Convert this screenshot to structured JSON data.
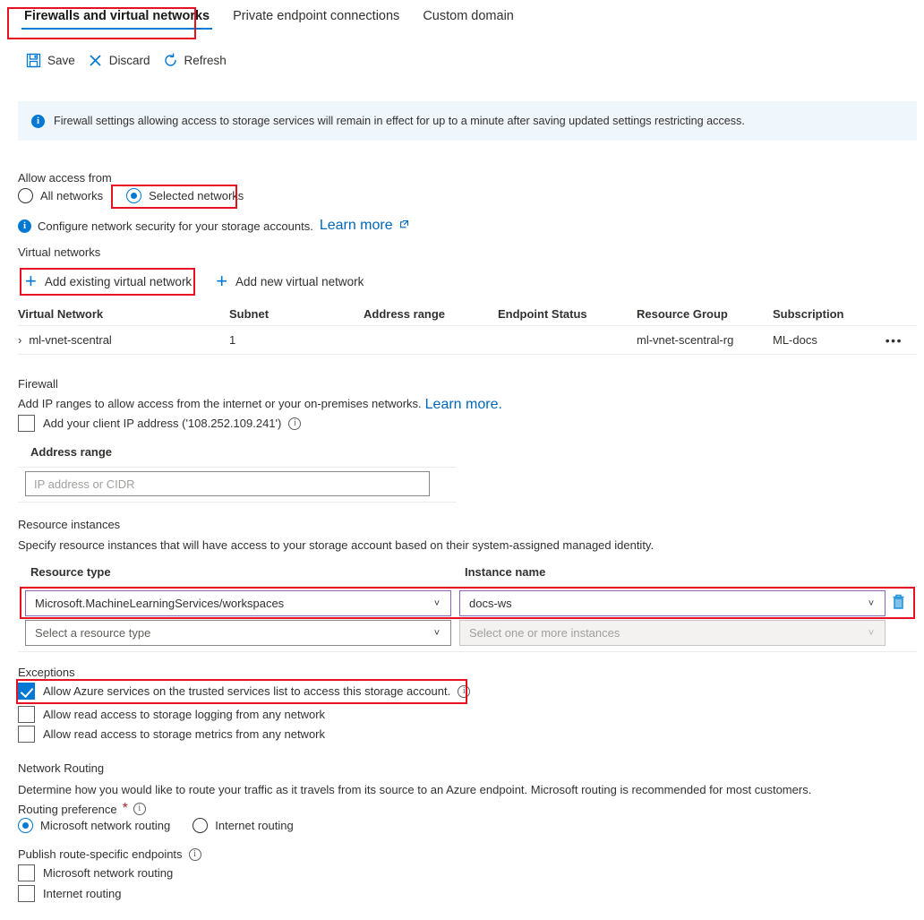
{
  "tabs": [
    {
      "label": "Firewalls and virtual networks",
      "active": true
    },
    {
      "label": "Private endpoint connections",
      "active": false
    },
    {
      "label": "Custom domain",
      "active": false
    }
  ],
  "toolbar": {
    "save_label": "Save",
    "discard_label": "Discard",
    "refresh_label": "Refresh"
  },
  "banner": {
    "text": "Firewall settings allowing access to storage services will remain in effect for up to a minute after saving updated settings restricting access."
  },
  "allow_access": {
    "heading": "Allow access from",
    "option_all": "All networks",
    "option_selected": "Selected networks",
    "selected_value": "Selected networks",
    "note": "Configure network security for your storage accounts.",
    "note_link": "Learn more"
  },
  "virtual_networks": {
    "heading": "Virtual networks",
    "add_existing": "Add existing virtual network",
    "add_new": "Add new virtual network",
    "columns": [
      "Virtual Network",
      "Subnet",
      "Address range",
      "Endpoint Status",
      "Resource Group",
      "Subscription"
    ],
    "rows": [
      {
        "virtual_network": "ml-vnet-scentral",
        "subnet": "1",
        "address_range": "",
        "endpoint_status": "",
        "resource_group": "ml-vnet-scentral-rg",
        "subscription": "ML-docs",
        "menu": "•••"
      }
    ]
  },
  "firewall": {
    "heading": "Firewall",
    "description": "Add IP ranges to allow access from the internet or your on-premises networks.",
    "description_link": "Learn more.",
    "client_ip_checkbox": "Add your client IP address ('108.252.109.241')",
    "client_ip_checked": false,
    "address_range_label": "Address range",
    "address_range_value": "",
    "address_range_placeholder": "IP address or CIDR"
  },
  "resource_instances": {
    "heading": "Resource instances",
    "description": "Specify resource instances that will have access to your storage account based on their system-assigned managed identity.",
    "col_resource_type": "Resource type",
    "col_instance_name": "Instance name",
    "rows": [
      {
        "resource_type": "Microsoft.MachineLearningServices/workspaces",
        "instance_name": "docs-ws",
        "has_delete": true
      },
      {
        "resource_type": "Select a resource type",
        "instance_name": "Select one or more instances",
        "has_delete": false
      }
    ]
  },
  "exceptions": {
    "heading": "Exceptions",
    "items": [
      {
        "label": "Allow Azure services on the trusted services list to access this storage account.",
        "checked": true,
        "info": true
      },
      {
        "label": "Allow read access to storage logging from any network",
        "checked": false,
        "info": false
      },
      {
        "label": "Allow read access to storage metrics from any network",
        "checked": false,
        "info": false
      }
    ]
  },
  "network_routing": {
    "heading": "Network Routing",
    "description": "Determine how you would like to route your traffic as it travels from its source to an Azure endpoint. Microsoft routing is recommended for most customers.",
    "routing_preference_label": "Routing preference",
    "routing_required_mark": "*",
    "routing_options": [
      {
        "label": "Microsoft network routing",
        "selected": true
      },
      {
        "label": "Internet routing",
        "selected": false
      }
    ],
    "publish_label": "Publish route-specific endpoints",
    "publish_options": [
      {
        "label": "Microsoft network routing",
        "checked": false
      },
      {
        "label": "Internet routing",
        "checked": false
      }
    ]
  },
  "colors": {
    "accent": "#0078d4",
    "highlight": "#e81123",
    "banner_bg": "#eff6fc",
    "link": "#0067b8",
    "focus_border": "#8764b8"
  }
}
